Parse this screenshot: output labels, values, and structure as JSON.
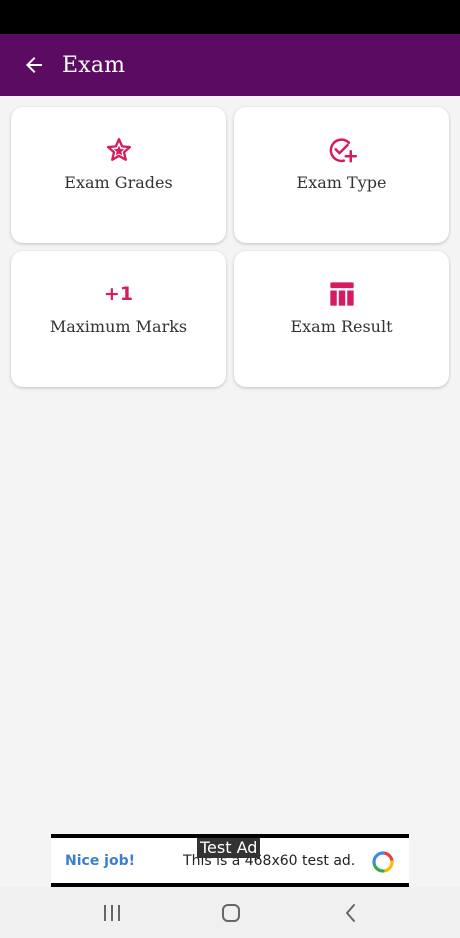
{
  "app_bar": {
    "title": "Exam",
    "back_icon": "arrow-left-icon",
    "color": "#5c0b62"
  },
  "accent_color": "#d81b60",
  "cards": [
    {
      "label": "Exam Grades",
      "icon": "star-icon"
    },
    {
      "label": "Exam Type",
      "icon": "check-circle-plus-icon"
    },
    {
      "label": "Maximum Marks",
      "icon": "plus-one-icon",
      "icon_text": "+1"
    },
    {
      "label": "Exam Result",
      "icon": "table-icon"
    }
  ],
  "ad": {
    "tag": "Test Ad",
    "left_text": "Nice job!",
    "center_text": "This is a 468x60 test ad.",
    "logo_icon": "adchoices-logo-icon"
  },
  "nav": {
    "recents_icon": "recents-icon",
    "home_icon": "home-icon",
    "back_icon": "back-chevron-icon"
  }
}
